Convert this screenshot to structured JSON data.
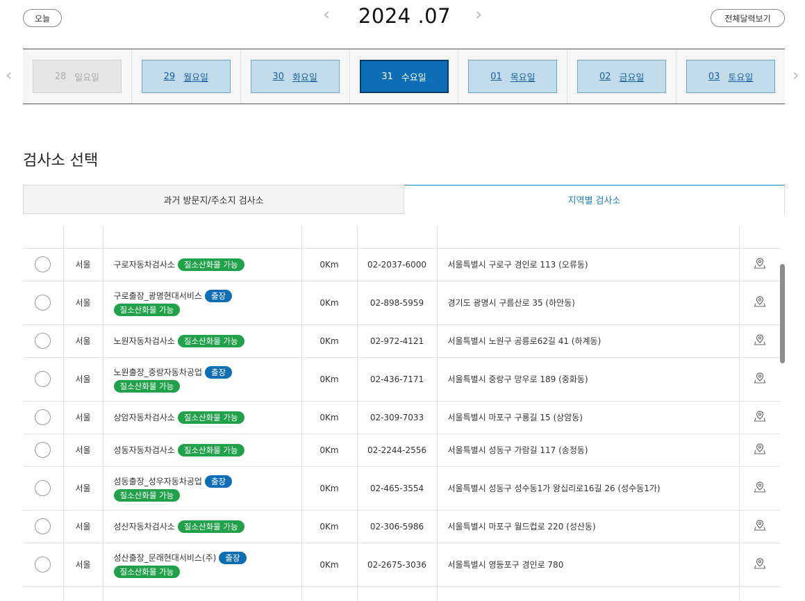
{
  "header": {
    "today_label": "오늘",
    "month_title": "2024 .07",
    "full_calendar_label": "전체달력보기",
    "prev_glyph": "‹",
    "next_glyph": "›"
  },
  "days": [
    {
      "num": "28",
      "weekday": "일요일",
      "state": "disabled"
    },
    {
      "num": "29",
      "weekday": "월요일",
      "state": "normal"
    },
    {
      "num": "30",
      "weekday": "화요일",
      "state": "normal"
    },
    {
      "num": "31",
      "weekday": "수요일",
      "state": "selected"
    },
    {
      "num": "01",
      "weekday": "목요일",
      "state": "normal"
    },
    {
      "num": "02",
      "weekday": "금요일",
      "state": "normal"
    },
    {
      "num": "03",
      "weekday": "토요일",
      "state": "normal"
    }
  ],
  "section_title": "검사소 선택",
  "tabs": [
    {
      "label": "과거 방문지/주소지 검사소",
      "active": false
    },
    {
      "label": "지역별 검사소",
      "active": true
    }
  ],
  "badges": {
    "green": "질소산화물 가능",
    "blue": "출장"
  },
  "rows": [
    {
      "region": "서울",
      "name": "구로자동차검사소",
      "trip": false,
      "distance": "0Km",
      "phone": "02-2037-6000",
      "address": "서울특별시 구로구 경인로 113 (오류동)"
    },
    {
      "region": "서울",
      "name": "구로출장_광명현대서비스",
      "trip": true,
      "distance": "0Km",
      "phone": "02-898-5959",
      "address": "경기도 광명시 구름산로 35 (하안동)"
    },
    {
      "region": "서울",
      "name": "노원자동차검사소",
      "trip": false,
      "distance": "0Km",
      "phone": "02-972-4121",
      "address": "서울특별시 노원구 공릉로62길 41 (하계동)"
    },
    {
      "region": "서울",
      "name": "노원출장_중랑자동차공업",
      "trip": true,
      "distance": "0Km",
      "phone": "02-436-7171",
      "address": "서울특별시 중랑구 망우로 189 (중화동)"
    },
    {
      "region": "서울",
      "name": "상암자동차검사소",
      "trip": false,
      "distance": "0Km",
      "phone": "02-309-7033",
      "address": "서울특별시 마포구 구룡길 15 (상암동)"
    },
    {
      "region": "서울",
      "name": "성동자동차검사소",
      "trip": false,
      "distance": "0Km",
      "phone": "02-2244-2556",
      "address": "서울특별시 성동구 가람길 117 (송정동)"
    },
    {
      "region": "서울",
      "name": "성동출장_성우자동차공업",
      "trip": true,
      "distance": "0Km",
      "phone": "02-465-3554",
      "address": "서울특별시 성동구 성수동1가 왕십리로16길 26 (성수동1가)"
    },
    {
      "region": "서울",
      "name": "성산자동차검사소",
      "trip": false,
      "distance": "0Km",
      "phone": "02-306-5986",
      "address": "서울특별시 마포구 월드컵로 220 (성산동)"
    },
    {
      "region": "서울",
      "name": "성산출장_문래현대서비스(주)",
      "trip": true,
      "distance": "0Km",
      "phone": "02-2675-3036",
      "address": "서울특별시 영등포구 경인로 780"
    }
  ],
  "colors": {
    "accent": "#0e6eb5",
    "badge_green": "#21a24a",
    "day_normal": "#c2dcec"
  }
}
